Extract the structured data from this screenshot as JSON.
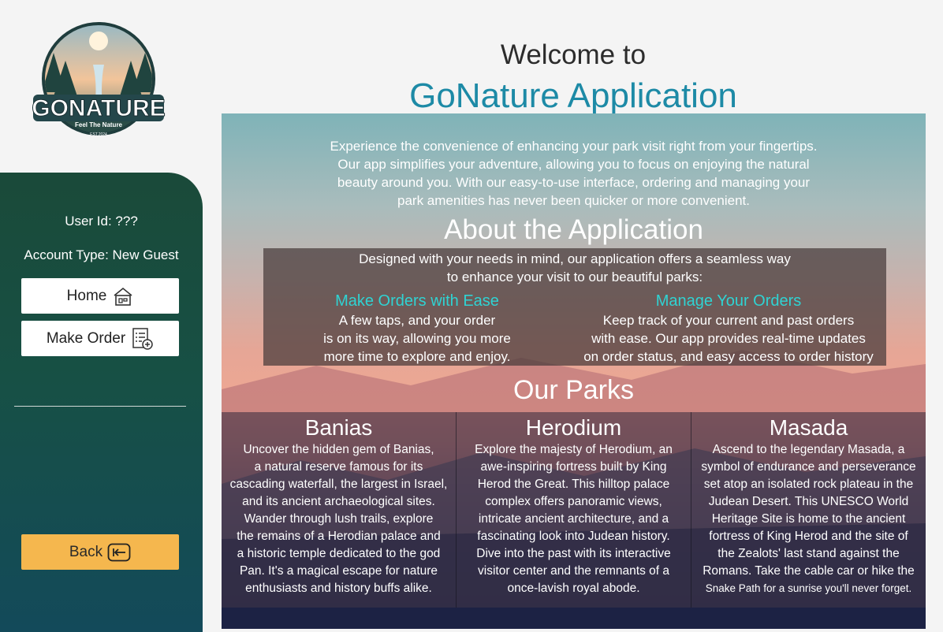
{
  "sidebar": {
    "logo": {
      "brand": "GONATURE",
      "tagline": "Feel The Nature",
      "est": "EST.2024"
    },
    "user_id": "User Id: ???",
    "account_type": "Account Type: New Guest",
    "home_label": "Home",
    "make_order_label": "Make Order",
    "back_label": "Back",
    "icons": {
      "home": "house-icon",
      "make_order": "order-form-icon",
      "back": "back-arrow-icon"
    }
  },
  "header": {
    "welcome": "Welcome to",
    "title": "GoNature Application"
  },
  "intro": {
    "line1": "Experience the convenience of enhancing your park visit right from your fingertips.",
    "line2": "Our app simplifies your adventure, allowing you to focus on enjoying the natural",
    "line3": "beauty around you. With our easy-to-use interface, ordering and managing your",
    "line4": "park amenities has never been quicker or more convenient."
  },
  "about": {
    "title": "About the Application",
    "desc1": "Designed with your needs in mind, our application offers a seamless way",
    "desc2": "to enhance your visit to our beautiful parks:",
    "features": [
      {
        "title": "Make Orders with Ease",
        "line1": "A few taps, and your order",
        "line2": "is on its way, allowing you more",
        "line3": "more time to explore and enjoy."
      },
      {
        "title": "Manage Your Orders",
        "line1": "Keep track of your current and past orders",
        "line2": "with ease. Our app provides real-time updates",
        "line3": "on order status, and easy access to order history"
      }
    ]
  },
  "parks": {
    "title": "Our Parks",
    "items": [
      {
        "name": "Banias",
        "lines": [
          "Uncover the hidden gem of Banias,",
          "a natural reserve famous for its",
          "cascading waterfall, the largest in Israel,",
          "and its ancient archaeological sites.",
          "Wander through lush trails, explore",
          "the remains of a Herodian palace and",
          "a historic temple dedicated to the god",
          "Pan. It's a magical escape for nature",
          "enthusiasts and history buffs alike."
        ]
      },
      {
        "name": "Herodium",
        "lines": [
          "Explore the majesty of Herodium, an",
          "awe-inspiring fortress built by King",
          "Herod the Great. This hilltop palace",
          "complex offers panoramic views,",
          "intricate ancient architecture, and a",
          "fascinating look into Judean history.",
          "Dive into the past with its interactive",
          "visitor center and the remnants of a",
          "once-lavish royal abode."
        ]
      },
      {
        "name": "Masada",
        "lines": [
          "Ascend to the legendary Masada, a",
          "symbol of endurance and perseverance",
          "set atop an isolated rock plateau in the",
          "Judean Desert. This UNESCO World",
          "Heritage Site is home to the ancient",
          "fortress of King Herod and the site of",
          "the Zealots' last stand against the",
          "Romans. Take the cable car or hike the",
          "Snake Path for a sunrise you'll never forget."
        ]
      }
    ]
  },
  "colors": {
    "sidebar": "#175045",
    "title_accent": "#1d8aa6",
    "feature_accent": "#2fd3d3",
    "back_button": "#f5b74e"
  }
}
